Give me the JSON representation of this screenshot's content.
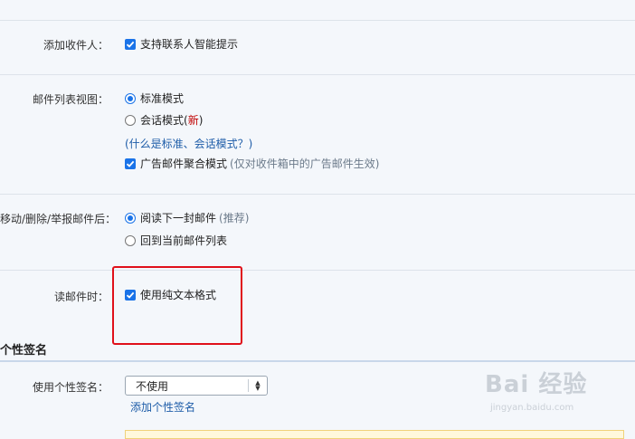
{
  "settings": {
    "add_recipient": {
      "label": "添加收件人：",
      "option": "支持联系人智能提示",
      "checked": true
    },
    "mail_list_view": {
      "label": "邮件列表视图：",
      "options": [
        {
          "text": "标准模式",
          "selected": true
        },
        {
          "text": "会话模式(",
          "badge": "新",
          "suffix": ")",
          "selected": false
        }
      ],
      "help_link": "(什么是标准、会话模式？)",
      "ad_aggregate": {
        "text": "广告邮件聚合模式",
        "note": "(仅对收件箱中的广告邮件生效)",
        "checked": true
      }
    },
    "after_action": {
      "label": "移动/删除/举报邮件后：",
      "options": [
        {
          "text": "阅读下一封邮件",
          "note": "(推荐)",
          "selected": true
        },
        {
          "text": "回到当前邮件列表",
          "selected": false
        }
      ]
    },
    "reading": {
      "label": "读邮件时：",
      "option": "使用纯文本格式",
      "checked": true
    }
  },
  "signature": {
    "section_title": "个性签名",
    "label": "使用个性签名：",
    "selected": "不使用",
    "add_link": "添加个性签名"
  },
  "watermark": {
    "text": "Bai 经验",
    "sub": "jingyan.baidu.com"
  },
  "colors": {
    "accent": "#1a73e8",
    "link": "#1d5ca8",
    "highlight": "#e0101a",
    "new_badge": "#c00000"
  }
}
